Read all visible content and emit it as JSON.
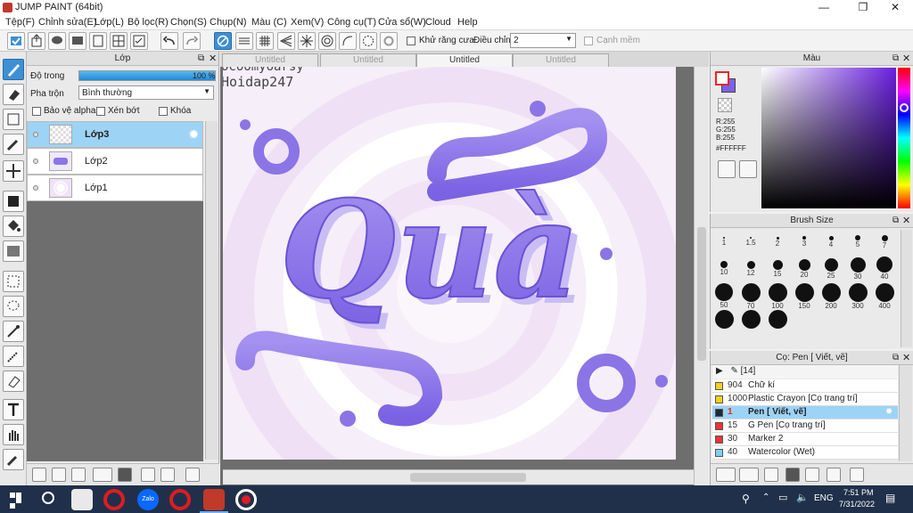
{
  "titlebar": {
    "title": "JUMP PAINT (64bit)",
    "minimize_icon": "minimize-icon",
    "maximize_icon": "restore-icon",
    "close_icon": "close-icon"
  },
  "menubar": {
    "items": [
      "Tệp(F)",
      "Chỉnh sửa(E)",
      "Lớp(L)",
      "Bộ lọc(R)",
      "Chọn(S)",
      "Chụp(N)",
      "Màu (C)",
      "Xem(V)",
      "Công cụ(T)",
      "Cửa sổ(W)",
      "Cloud",
      "Help"
    ]
  },
  "toolbar": {
    "antialias_label": "Khử răng cưa",
    "adjust_label": "Điều chỉnh",
    "adjust_value": "2",
    "sharp_label": "Cạnh mềm"
  },
  "layer_panel": {
    "title": "Lớp",
    "opacity_label": "Độ trong",
    "opacity_value": "100 %",
    "blend_label": "Pha trộn",
    "blend_value": "Bình thường",
    "protect_alpha": "Bảo vệ alpha",
    "clip": "Xén bớt",
    "lock": "Khóa",
    "layers": [
      {
        "name": "Lớp3",
        "selected": true
      },
      {
        "name": "Lớp2",
        "selected": false
      },
      {
        "name": "Lớp1",
        "selected": false
      }
    ]
  },
  "canvas": {
    "tabs": [
      "Untitled",
      "Untitled",
      "Untitled",
      "Untitled"
    ],
    "active_tab": 2,
    "watermark_line1": "ocoomyoarsy",
    "watermark_line2": "Hoidap247",
    "art_text": "Quà",
    "art_color": "#8b74e6"
  },
  "color_panel": {
    "title": "Màu",
    "r": "R:255",
    "g": "G:255",
    "b": "B:255",
    "hex": "#FFFFFF",
    "primary_color": "#ffffff",
    "secondary_color": "#7b61e8"
  },
  "brush_panel": {
    "title": "Brush Size",
    "sizes": [
      "1",
      "1.5",
      "2",
      "3",
      "4",
      "5",
      "7",
      "10",
      "12",
      "15",
      "20",
      "25",
      "30",
      "40",
      "50",
      "70",
      "100",
      "150",
      "200",
      "300",
      "400",
      "",
      "",
      ""
    ]
  },
  "tool_panel": {
    "title": "Cọ: Pen [ Viết, vẽ]",
    "header": "[14]",
    "items": [
      {
        "num": "904",
        "name": "Chữ kí",
        "color": "#f2d21a",
        "selected": false
      },
      {
        "num": "1000",
        "name": "Plastic Crayon [Cọ trang trí]",
        "color": "#f2d21a",
        "selected": false
      },
      {
        "num": "1",
        "name": "Pen [ Viết, vẽ]",
        "color": "#1a2a3a",
        "selected": true
      },
      {
        "num": "15",
        "name": "G Pen [Cọ trang trí]",
        "color": "#e33",
        "selected": false
      },
      {
        "num": "30",
        "name": "Marker 2",
        "color": "#e33",
        "selected": false
      },
      {
        "num": "40",
        "name": "Watercolor (Wet)",
        "color": "#7fd0f5",
        "selected": false
      }
    ]
  },
  "taskbar": {
    "time": "7:51 PM",
    "date": "7/31/2022",
    "lang": "ENG"
  }
}
